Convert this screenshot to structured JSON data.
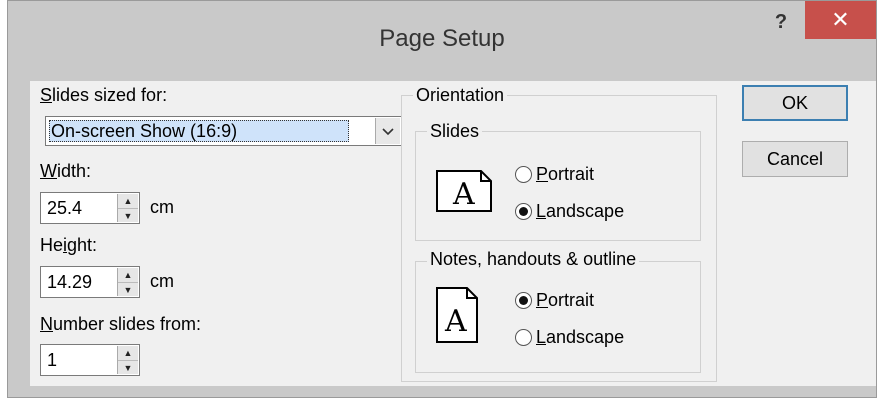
{
  "window": {
    "title": "Page Setup",
    "help_label": "?",
    "close_label": "✕"
  },
  "slides_sized_for": {
    "label_u": "S",
    "label_rest": "lides sized for:",
    "value": "On-screen Show (16:9)",
    "chevron": "chevron-down-icon"
  },
  "width": {
    "label_u": "W",
    "label_rest": "idth:",
    "value": "25.4",
    "unit": "cm"
  },
  "height": {
    "label_pre": "He",
    "label_u": "i",
    "label_rest": "ght:",
    "value": "14.29",
    "unit": "cm"
  },
  "number_from": {
    "label_u": "N",
    "label_rest": "umber slides from:",
    "value": "1"
  },
  "orientation": {
    "title": "Orientation",
    "slides": {
      "title": "Slides",
      "icon_letter": "A",
      "portrait_u": "P",
      "portrait_rest": "ortrait",
      "landscape_u": "L",
      "landscape_rest": "andscape",
      "selected": "landscape"
    },
    "notes": {
      "title": "Notes, handouts & outline",
      "icon_letter": "A",
      "portrait_u": "P",
      "portrait_rest": "ortrait",
      "landscape_u": "L",
      "landscape_rest": "andscape",
      "selected": "portrait"
    }
  },
  "buttons": {
    "ok": "OK",
    "cancel": "Cancel"
  }
}
